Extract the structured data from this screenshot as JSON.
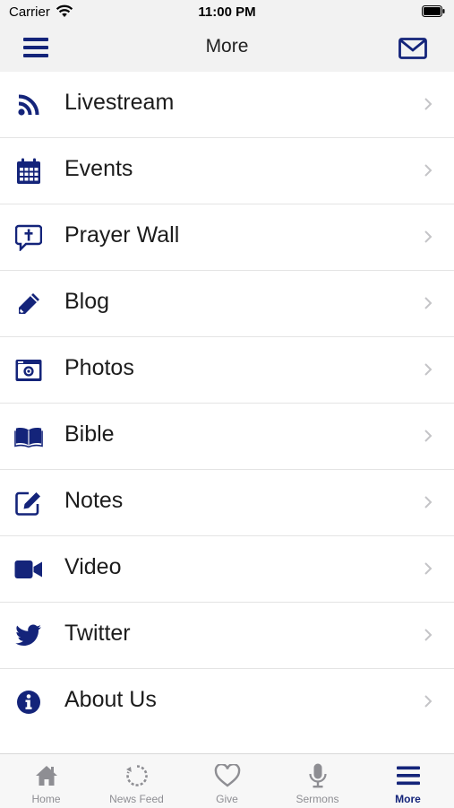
{
  "status_bar": {
    "carrier": "Carrier",
    "time": "11:00 PM"
  },
  "header": {
    "title": "More",
    "left_icon": "hamburger-menu-icon",
    "right_icon": "mail-icon"
  },
  "menu_items": [
    {
      "label": "Livestream",
      "icon": "rss-icon"
    },
    {
      "label": "Events",
      "icon": "calendar-icon"
    },
    {
      "label": "Prayer Wall",
      "icon": "prayer-bubble-icon"
    },
    {
      "label": "Blog",
      "icon": "pencil-icon"
    },
    {
      "label": "Photos",
      "icon": "camera-icon"
    },
    {
      "label": "Bible",
      "icon": "book-icon"
    },
    {
      "label": "Notes",
      "icon": "notes-icon"
    },
    {
      "label": "Video",
      "icon": "video-camera-icon"
    },
    {
      "label": "Twitter",
      "icon": "twitter-icon"
    },
    {
      "label": "About Us",
      "icon": "info-icon"
    }
  ],
  "tab_bar": {
    "tabs": [
      {
        "label": "Home",
        "icon": "home-icon",
        "active": false
      },
      {
        "label": "News Feed",
        "icon": "news-feed-icon",
        "active": false
      },
      {
        "label": "Give",
        "icon": "heart-icon",
        "active": false
      },
      {
        "label": "Sermons",
        "icon": "microphone-icon",
        "active": false
      },
      {
        "label": "More",
        "icon": "more-menu-icon",
        "active": true
      }
    ]
  },
  "colors": {
    "accent": "#14247a",
    "inactive": "#8e8e93",
    "background": "#f2f2f2",
    "row_background": "#ffffff"
  }
}
